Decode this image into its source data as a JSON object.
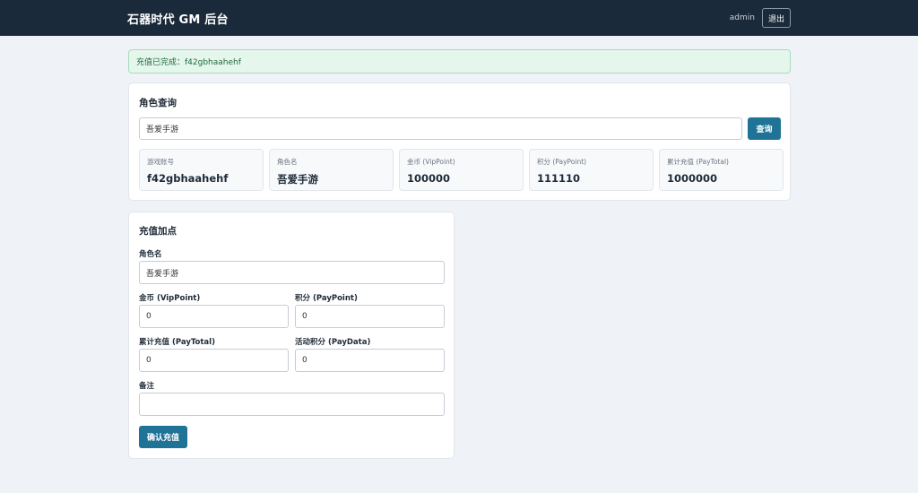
{
  "header": {
    "title": "石器时代 GM 后台",
    "user": "admin",
    "logout_label": "退出"
  },
  "alert": {
    "message": "充值已完成：f42gbhaahehf"
  },
  "query": {
    "title": "角色查询",
    "input_value": "吾爱手游",
    "button_label": "查询",
    "stats": [
      {
        "label": "游戏账号",
        "value": "f42gbhaahehf"
      },
      {
        "label": "角色名",
        "value": "吾爱手游"
      },
      {
        "label": "金币 (VipPoint)",
        "value": "100000"
      },
      {
        "label": "积分 (PayPoint)",
        "value": "111110"
      },
      {
        "label": "累计充值 (PayTotal)",
        "value": "1000000"
      }
    ]
  },
  "recharge": {
    "title": "充值加点",
    "fields": {
      "role_name": {
        "label": "角色名",
        "value": "吾爱手游"
      },
      "vip_point": {
        "label": "金币 (VipPoint)",
        "value": "0"
      },
      "pay_point": {
        "label": "积分 (PayPoint)",
        "value": "0"
      },
      "pay_total": {
        "label": "累计充值 (PayTotal)",
        "value": "0"
      },
      "pay_data": {
        "label": "活动积分 (PayData)",
        "value": "0"
      },
      "note": {
        "label": "备注",
        "value": ""
      }
    },
    "confirm_label": "确认充值"
  }
}
